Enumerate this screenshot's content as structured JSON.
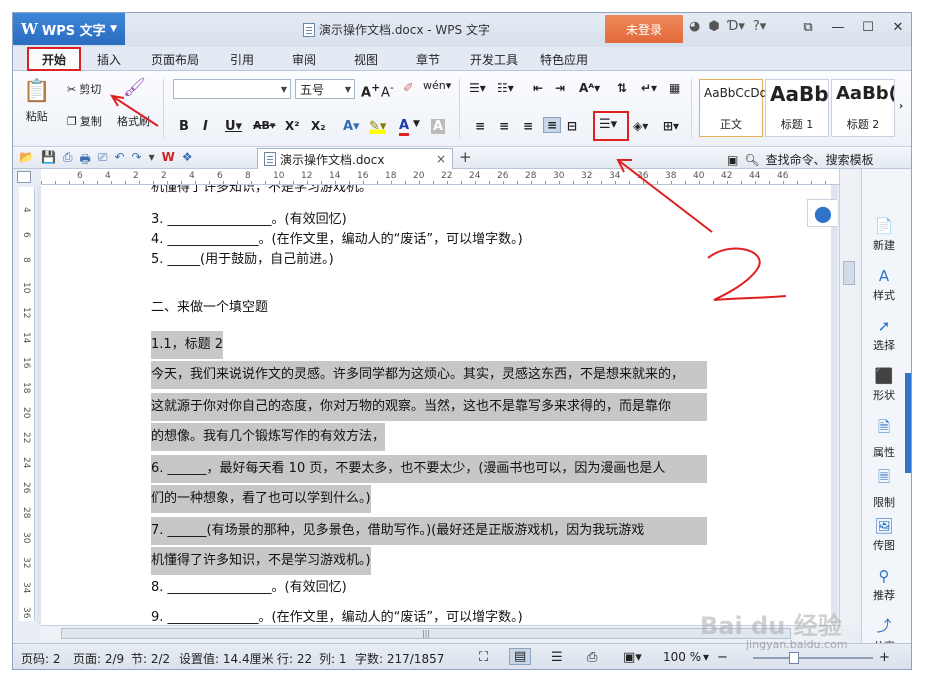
{
  "window": {
    "app_name": "WPS 文字",
    "doc_title": "演示操作文档.docx - WPS 文字",
    "login": "未登录",
    "icons": [
      "skin-icon",
      "settings-icon",
      "dropdown-icon",
      "help-icon"
    ]
  },
  "menu": {
    "tabs": [
      "开始",
      "插入",
      "页面布局",
      "引用",
      "审阅",
      "视图",
      "章节",
      "开发工具",
      "特色应用"
    ]
  },
  "ribbon": {
    "paste": "粘贴",
    "cut": "剪切",
    "copy": "复制",
    "format_painter": "格式刷",
    "font_size": "五号",
    "styles": [
      {
        "sample": "AaBbCcDd",
        "label": "正文"
      },
      {
        "sample": "AaBb",
        "label": "标题 1"
      },
      {
        "sample": "AaBb(",
        "label": "标题 2"
      }
    ]
  },
  "quickbar": {
    "doc_tab": "演示操作文档.docx",
    "search": "查找命令、搜索模板"
  },
  "ruler": {
    "labels": [
      "6",
      "4",
      "2",
      "2",
      "4",
      "6",
      "8",
      "10",
      "12",
      "14",
      "16",
      "18",
      "20",
      "22",
      "24",
      "26",
      "28",
      "30",
      "32",
      "34",
      "36",
      "38",
      "40",
      "42",
      "44",
      "46"
    ],
    "vlabels": [
      "4",
      "6",
      "8",
      "10",
      "12",
      "14",
      "16",
      "18",
      "20",
      "22",
      "24",
      "26",
      "28",
      "30",
      "32",
      "34",
      "36"
    ]
  },
  "document": {
    "lines": [
      {
        "text": "机懂得了许多知识，不是学习游戏机。",
        "selected": false,
        "cut": true
      },
      {
        "text": "3.  ________________。(有效回忆)",
        "selected": false
      },
      {
        "text": "4.  ______________。(在作文里，编动人的“废话”，可以增字数。)",
        "selected": false
      },
      {
        "text": "5.  _____(用于鼓励，自己前进。)",
        "selected": false
      },
      {
        "text": "二、来做一个填空题",
        "selected": false
      },
      {
        "text": "1.1，标题 2",
        "selected": true
      },
      {
        "text": "今天，我们来说说作文的灵感。许多同学都为这烦心。其实，灵感这东西，不是想来就来的，",
        "selected": true
      },
      {
        "text": "这就源于你对你自己的态度，你对万物的观察。当然，这也不是靠写多来求得的，而是靠你",
        "selected": true
      },
      {
        "text": "的想像。我有几个锻炼写作的有效方法，",
        "selected": true
      },
      {
        "text": "6.  ______，最好每天看 10 页，不要太多，也不要太少，(漫画书也可以，因为漫画也是人",
        "selected": true
      },
      {
        "text": "们的一种想象，看了也可以学到什么。)",
        "selected": true
      },
      {
        "text": "7.  ______(有场景的那种，见多景色，借助写作。)(最好还是正版游戏机，因为我玩游戏",
        "selected": true
      },
      {
        "text": "机懂得了许多知识，不是学习游戏机。)",
        "selected": true
      },
      {
        "text": "8.  ________________。(有效回忆)",
        "selected": false
      },
      {
        "text": "9.  ______________。(在作文里，编动人的“废话”，可以增字数。)",
        "selected": false
      }
    ]
  },
  "sidepanel": {
    "items": [
      "新建",
      "样式",
      "选择",
      "形状",
      "属性",
      "限制",
      "传图",
      "推荐",
      "分享"
    ]
  },
  "status": {
    "page_num": "页码: 2",
    "pages": "页面: 2/9",
    "section": "节: 2/2",
    "setting": "设置值: 14.4厘米",
    "row": "行: 22",
    "col": "列: 1",
    "words": "字数: 217/1857",
    "zoom": "100 %"
  },
  "annotation": {
    "number": "2",
    "color": "#e02020"
  },
  "watermark": {
    "brand": "Bai du 经验",
    "url": "jingyan.baidu.com"
  }
}
